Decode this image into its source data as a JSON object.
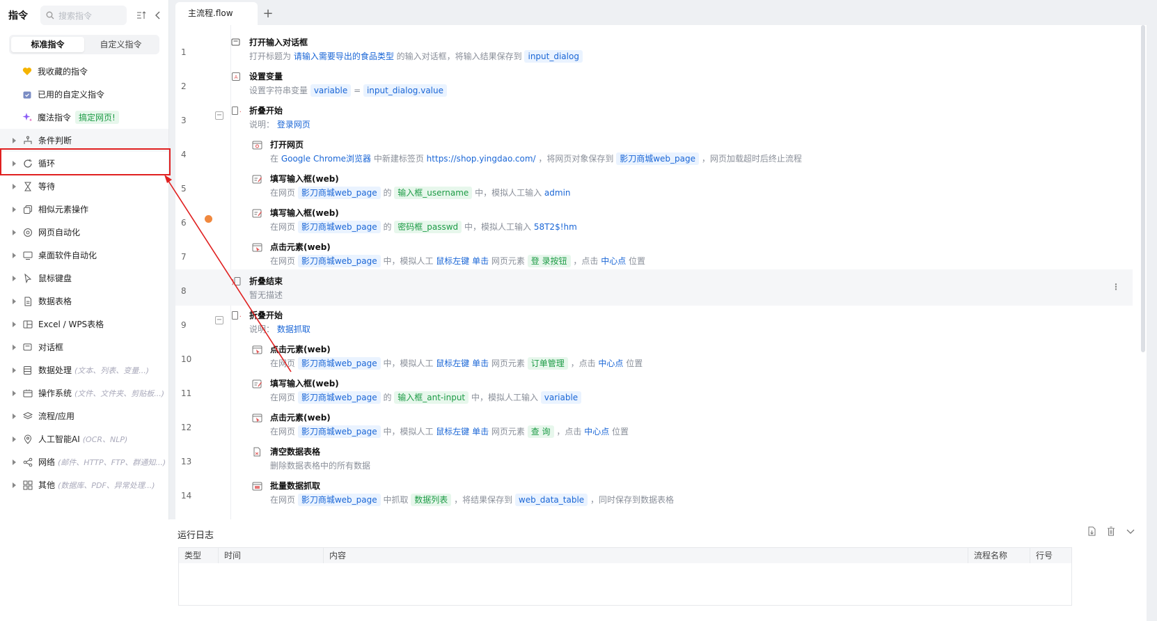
{
  "sidebar": {
    "title": "指令",
    "search_placeholder": "搜索指令",
    "tabs": [
      "标准指令",
      "自定义指令"
    ],
    "favorites": [
      {
        "label": "我收藏的指令",
        "icon": "heart-icon"
      },
      {
        "label": "已用的自定义指令",
        "icon": "calendar-icon"
      },
      {
        "label": "魔法指令",
        "icon": "sparkle-icon",
        "badge": "搞定网页!"
      }
    ],
    "categories": [
      {
        "label": "条件判断",
        "icon": "branch-icon",
        "hint": ""
      },
      {
        "label": "循环",
        "icon": "loop-icon",
        "hint": ""
      },
      {
        "label": "等待",
        "icon": "hourglass-icon",
        "hint": ""
      },
      {
        "label": "相似元素操作",
        "icon": "similar-icon",
        "hint": ""
      },
      {
        "label": "网页自动化",
        "icon": "browser-icon",
        "hint": ""
      },
      {
        "label": "桌面软件自动化",
        "icon": "monitor-icon",
        "hint": ""
      },
      {
        "label": "鼠标键盘",
        "icon": "cursor-icon",
        "hint": ""
      },
      {
        "label": "数据表格",
        "icon": "table-icon",
        "hint": ""
      },
      {
        "label": "Excel / WPS表格",
        "icon": "excel-icon",
        "hint": ""
      },
      {
        "label": "对话框",
        "icon": "dialog-icon",
        "hint": ""
      },
      {
        "label": "数据处理",
        "icon": "data-icon",
        "hint": "(文本、列表、变量...)"
      },
      {
        "label": "操作系统",
        "icon": "folder-icon",
        "hint": "(文件、文件夹、剪贴板...)"
      },
      {
        "label": "流程/应用",
        "icon": "layers-icon",
        "hint": ""
      },
      {
        "label": "人工智能AI",
        "icon": "ai-icon",
        "hint": "(OCR、NLP)"
      },
      {
        "label": "网络",
        "icon": "network-icon",
        "hint": "(邮件、HTTP、FTP、群通知...)"
      },
      {
        "label": "其他",
        "icon": "grid-icon",
        "hint": "(数据库、PDF、异常处理...)"
      }
    ]
  },
  "editor": {
    "tab_label": "主流程.flow",
    "add_tab": "+",
    "rows": [
      {
        "line": "1",
        "indent": 0,
        "icon": "dialog-icon",
        "title": "打开输入对话框",
        "desc": [
          {
            "t": "打开标题为 "
          },
          {
            "t": "请输入需要导出的食品类型",
            "s": "bl"
          },
          {
            "t": " 的输入对话框，将输入结果保存到 "
          },
          {
            "t": "input_dialog",
            "s": "b"
          }
        ]
      },
      {
        "line": "2",
        "indent": 0,
        "icon": "variable-icon",
        "title": "设置变量",
        "desc": [
          {
            "t": "设置字符串变量 "
          },
          {
            "t": "variable",
            "s": "b"
          },
          {
            "t": " = "
          },
          {
            "t": "input_dialog.value",
            "s": "b"
          }
        ]
      },
      {
        "line": "3",
        "indent": 0,
        "icon": "fold-start-icon",
        "title": "折叠开始",
        "collapse": true,
        "desc": [
          {
            "t": "说明： "
          },
          {
            "t": "登录网页",
            "s": "bl"
          }
        ]
      },
      {
        "line": "4",
        "indent": 1,
        "icon": "open-web-icon",
        "title": "打开网页",
        "desc": [
          {
            "t": "在 "
          },
          {
            "t": "Google Chrome浏览器",
            "s": "bl"
          },
          {
            "t": " 中新建标签页 "
          },
          {
            "t": "https://shop.yingdao.com/",
            "s": "bl"
          },
          {
            "t": " ，将网页对象保存到 "
          },
          {
            "t": "影刀商城web_page",
            "s": "b"
          },
          {
            "t": " ，网页加载超时后终止流程"
          }
        ]
      },
      {
        "line": "5",
        "indent": 1,
        "icon": "input-web-icon",
        "title": "填写输入框(web)",
        "desc": [
          {
            "t": "在网页 "
          },
          {
            "t": "影刀商城web_page",
            "s": "b"
          },
          {
            "t": " 的 "
          },
          {
            "t": "输入框_username",
            "s": "g"
          },
          {
            "t": " 中，模拟人工输入 "
          },
          {
            "t": "admin",
            "s": "bl"
          }
        ]
      },
      {
        "line": "6",
        "indent": 1,
        "icon": "input-web-icon",
        "title": "填写输入框(web)",
        "breakpoint": true,
        "desc": [
          {
            "t": "在网页 "
          },
          {
            "t": "影刀商城web_page",
            "s": "b"
          },
          {
            "t": " 的 "
          },
          {
            "t": "密码框_passwd",
            "s": "g"
          },
          {
            "t": " 中，模拟人工输入 "
          },
          {
            "t": "58T2$!hm",
            "s": "bl"
          }
        ]
      },
      {
        "line": "7",
        "indent": 1,
        "icon": "click-web-icon",
        "title": "点击元素(web)",
        "desc": [
          {
            "t": "在网页 "
          },
          {
            "t": "影刀商城web_page",
            "s": "b"
          },
          {
            "t": " 中，模拟人工 "
          },
          {
            "t": "鼠标左键 单击",
            "s": "bl"
          },
          {
            "t": " 网页元素 "
          },
          {
            "t": "登 录按钮",
            "s": "g"
          },
          {
            "t": " ，点击 "
          },
          {
            "t": "中心点",
            "s": "bl"
          },
          {
            "t": " 位置"
          }
        ]
      },
      {
        "line": "8",
        "indent": 0,
        "icon": "fold-end-icon",
        "title": "折叠结束",
        "highlight": true,
        "more": "⋮",
        "desc": [
          {
            "t": "暂无描述"
          }
        ]
      },
      {
        "line": "9",
        "indent": 0,
        "icon": "fold-start-icon",
        "title": "折叠开始",
        "collapse": true,
        "desc": [
          {
            "t": "说明： "
          },
          {
            "t": "数据抓取",
            "s": "bl"
          }
        ]
      },
      {
        "line": "10",
        "indent": 1,
        "icon": "click-web-icon",
        "title": "点击元素(web)",
        "desc": [
          {
            "t": "在网页 "
          },
          {
            "t": "影刀商城web_page",
            "s": "b"
          },
          {
            "t": " 中，模拟人工 "
          },
          {
            "t": "鼠标左键 单击",
            "s": "bl"
          },
          {
            "t": " 网页元素 "
          },
          {
            "t": "订单管理",
            "s": "g"
          },
          {
            "t": " ，点击 "
          },
          {
            "t": "中心点",
            "s": "bl"
          },
          {
            "t": " 位置"
          }
        ]
      },
      {
        "line": "11",
        "indent": 1,
        "icon": "input-web-icon",
        "title": "填写输入框(web)",
        "desc": [
          {
            "t": "在网页 "
          },
          {
            "t": "影刀商城web_page",
            "s": "b"
          },
          {
            "t": " 的 "
          },
          {
            "t": "输入框_ant-input",
            "s": "g"
          },
          {
            "t": " 中，模拟人工输入 "
          },
          {
            "t": "variable",
            "s": "b"
          }
        ]
      },
      {
        "line": "12",
        "indent": 1,
        "icon": "click-web-icon",
        "title": "点击元素(web)",
        "desc": [
          {
            "t": "在网页 "
          },
          {
            "t": "影刀商城web_page",
            "s": "b"
          },
          {
            "t": " 中，模拟人工 "
          },
          {
            "t": "鼠标左键 单击",
            "s": "bl"
          },
          {
            "t": " 网页元素 "
          },
          {
            "t": "查 询",
            "s": "g"
          },
          {
            "t": " ，点击 "
          },
          {
            "t": "中心点",
            "s": "bl"
          },
          {
            "t": " 位置"
          }
        ]
      },
      {
        "line": "13",
        "indent": 1,
        "icon": "clear-table-icon",
        "title": "清空数据表格",
        "desc": [
          {
            "t": "删除数据表格中的所有数据"
          }
        ]
      },
      {
        "line": "14",
        "indent": 1,
        "icon": "batch-scrape-icon",
        "title": "批量数据抓取",
        "desc": [
          {
            "t": "在网页 "
          },
          {
            "t": "影刀商城web_page",
            "s": "b"
          },
          {
            "t": " 中抓取 "
          },
          {
            "t": "数据列表",
            "s": "g"
          },
          {
            "t": " ，将结果保存到 "
          },
          {
            "t": "web_data_table",
            "s": "b"
          },
          {
            "t": " ，同时保存到数据表格"
          }
        ]
      }
    ]
  },
  "log": {
    "title": "运行日志",
    "columns": [
      "类型",
      "时间",
      "内容",
      "流程名称",
      "行号"
    ]
  },
  "colors": {
    "accent": "#1a66d6",
    "green": "#1c9b45",
    "annotation": "#e02020",
    "breakpoint": "#f0883e"
  }
}
